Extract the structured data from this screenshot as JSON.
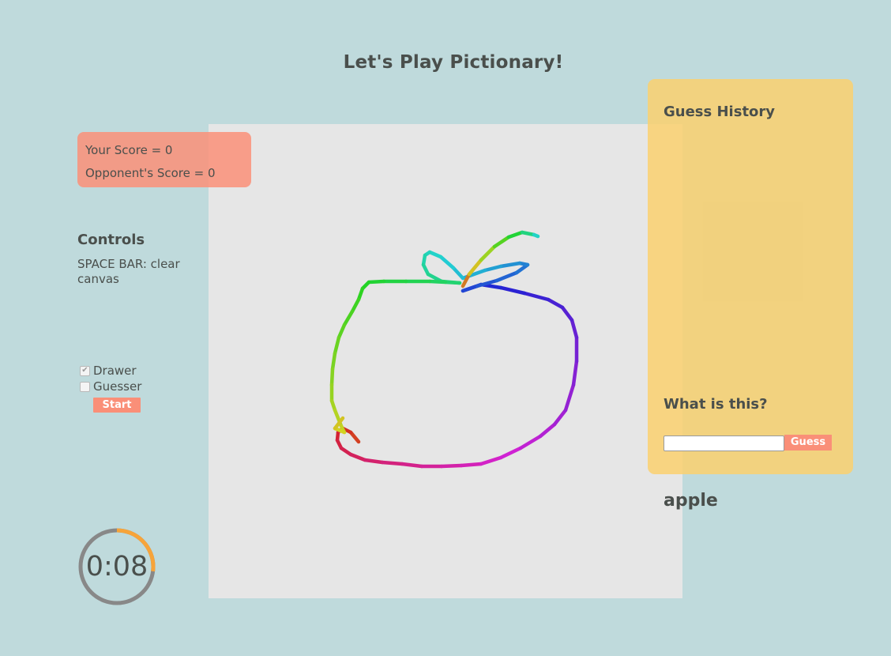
{
  "title": "Let's Play Pictionary!",
  "scores": {
    "yours": "Your Score = 0",
    "opponent": "Opponent's Score = 0"
  },
  "controls": {
    "title": "Controls",
    "text": "SPACE BAR: clear canvas"
  },
  "roles": {
    "drawer": {
      "label": "Drawer",
      "checked": true
    },
    "guesser": {
      "label": "Guesser",
      "checked": false
    }
  },
  "start_label": "Start",
  "timer": {
    "text": "0:08",
    "remaining_fraction": 0.27,
    "ring_color": "#888888",
    "progress_color": "#f7a43a"
  },
  "guess_panel": {
    "history_title": "Guess History",
    "history": [],
    "question": "What is this?",
    "input_value": "",
    "guess_label": "Guess"
  },
  "current_word": "apple",
  "colors": {
    "background": "#bfdadc",
    "canvas": "#e6e6e6",
    "accent": "#fa8f78",
    "panel": "#fad06e"
  }
}
